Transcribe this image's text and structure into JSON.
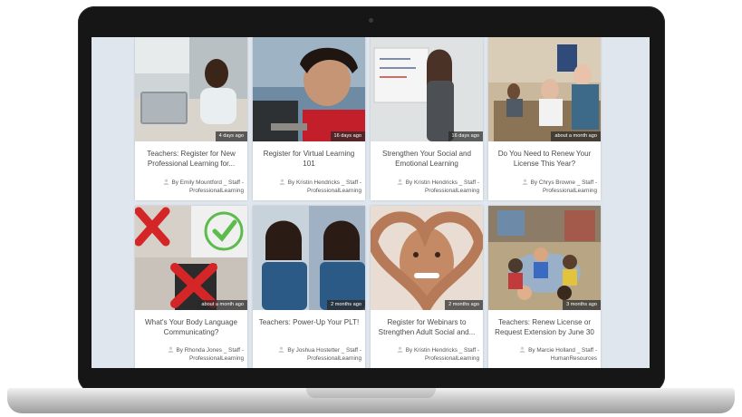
{
  "posts": [
    {
      "title": "Teachers: Register for New Professional Learning for...",
      "author": "By Emily Mountford _ Staff -",
      "team": "ProfessionalLearning",
      "age": "4 days ago"
    },
    {
      "title": "Register for Virtual Learning 101",
      "author": "By Kristin Hendricks _ Staff -",
      "team": "ProfessionalLearning",
      "age": "16 days ago"
    },
    {
      "title": "Strengthen Your Social and Emotional Learning",
      "author": "By Kristin Hendricks _ Staff -",
      "team": "ProfessionalLearning",
      "age": "16 days ago"
    },
    {
      "title": "Do You Need to Renew Your License This Year?",
      "author": "By Chrys Browne _ Staff -",
      "team": "ProfessionalLearning",
      "age": "about a month ago"
    },
    {
      "title": "What's Your Body Language Communicating?",
      "author": "By Rhonda Jones _ Staff -",
      "team": "ProfessionalLearning",
      "age": "about a month ago"
    },
    {
      "title": "Teachers: Power-Up Your PLT!",
      "author": "By Joshua Hostetter _ Staff -",
      "team": "ProfessionalLearning",
      "age": "2 months ago"
    },
    {
      "title": "Register for Webinars to Strengthen Adult Social and...",
      "author": "By Kristin Hendricks _ Staff -",
      "team": "ProfessionalLearning",
      "age": "2 months ago"
    },
    {
      "title": "Teachers: Renew License or Request Extension by June 30",
      "author": "By Marcie Holland _ Staff -",
      "team": "HumanResources",
      "age": "3 months ago"
    }
  ],
  "icons": {
    "author": "user-icon"
  }
}
